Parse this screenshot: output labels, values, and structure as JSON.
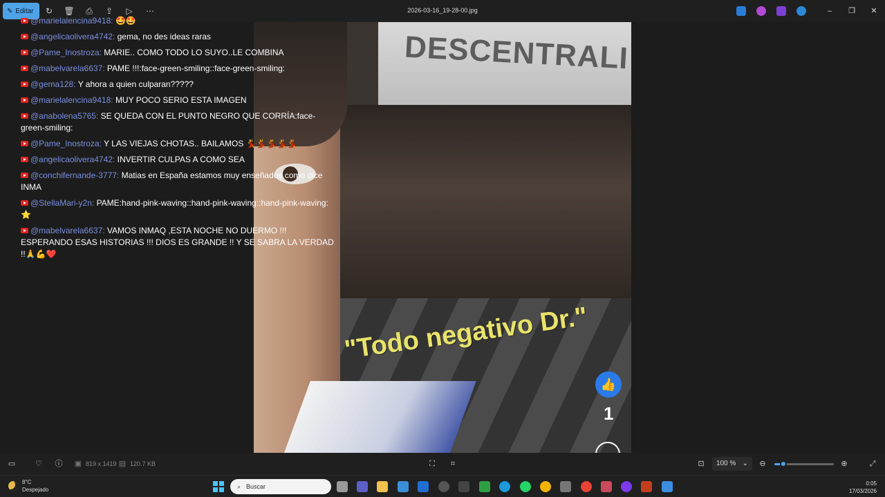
{
  "titlebar": {
    "edit_label": "Editar",
    "file_name": "2026-03-16_19-28-00.jpg",
    "icons": [
      "rotate-icon",
      "delete-icon",
      "print-icon",
      "share-icon",
      "slideshow-icon",
      "more-icon"
    ],
    "window_controls": [
      "minimize",
      "maximize",
      "close"
    ]
  },
  "chat": {
    "messages": [
      {
        "user": "@marielalencina9418:",
        "text": "🤩🤩"
      },
      {
        "user": "@angelicaolivera4742:",
        "text": "gema, no des ideas raras"
      },
      {
        "user": "@Pame_Inostroza:",
        "text": "MARIE.. COMO TODO LO SUYO..LE COMBINA"
      },
      {
        "user": "@mabelvarela6637:",
        "text": "PAME !!!:face-green-smiling::face-green-smiling:"
      },
      {
        "user": "@gema128:",
        "text": "Y ahora a quien culparan?????"
      },
      {
        "user": "@marielalencina9418:",
        "text": "MUY POCO SERIO ESTA IMAGEN"
      },
      {
        "user": "@anabolena5765:",
        "text": "SE QUEDA CON EL PUNTO NEGRO QUE CORRÍA:face-green-smiling:"
      },
      {
        "user": "@Pame_Inostroza:",
        "text": "Y LAS VIEJAS CHOTAS.. BAILAMOS 💃💃💃💃💃"
      },
      {
        "user": "@angelicaolivera4742:",
        "text": "INVERTIR CULPAS A COMO SEA"
      },
      {
        "user": "@conchifernande-3777:",
        "text": "Matias en España estamos muy enseñados como dice INMA"
      },
      {
        "user": "@StellaMari-y2n:",
        "text": "PAME:hand-pink-waving::hand-pink-waving::hand-pink-waving: ⭐"
      },
      {
        "user": "@mabelvarela6637:",
        "text": "VAMOS INMAQ ,ESTA NOCHE NO DUERMO !!! ESPERANDO ESAS HISTORIAS !!! DIOS ES GRANDE !! Y SE SABRA LA VERDAD !!🙏💪❤️"
      }
    ]
  },
  "photo": {
    "sign_text": "DESCENTRALI",
    "overlay_text": "\"Todo negativo Dr.\"",
    "like_count": "1"
  },
  "statusbar": {
    "dimensions": "819 x 1419",
    "file_size": "120.7 KB",
    "zoom": "100 %",
    "zoom_level": 0.15
  },
  "taskbar": {
    "weather_temp": "8°C",
    "weather_desc": "Despejado",
    "search_placeholder": "Buscar",
    "time": "0:05",
    "date": "17/03/2026"
  }
}
